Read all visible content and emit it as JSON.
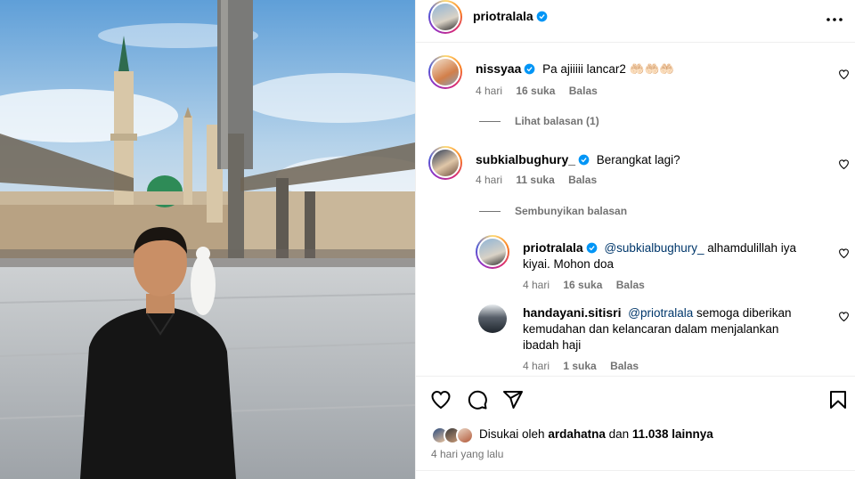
{
  "post": {
    "author": "priotralala",
    "author_verified": true
  },
  "comments": [
    {
      "username": "nissyaa",
      "verified": true,
      "text": "Pa ajiiiii lancar2 🤲🏻🤲🏻🤲🏻",
      "time": "4 hari",
      "likes": "16 suka",
      "reply_label": "Balas",
      "replies_toggle": "Lihat balasan (1)"
    },
    {
      "username": "subkialbughury_",
      "verified": true,
      "text": "Berangkat lagi?",
      "time": "4 hari",
      "likes": "11 suka",
      "reply_label": "Balas",
      "replies_toggle": "Sembunyikan balasan",
      "replies": [
        {
          "username": "priotralala",
          "verified": true,
          "mention": "@subkialbughury_",
          "text": " alhamdulillah iya kiyai. Mohon doa",
          "time": "4 hari",
          "likes": "16 suka",
          "reply_label": "Balas"
        },
        {
          "username": "handayani.sitisri",
          "verified": false,
          "mention": "@priotralala",
          "text": " semoga diberikan kemudahan dan kelancaran dalam menjalankan ibadah haji",
          "time": "4 hari",
          "likes": "1 suka",
          "reply_label": "Balas"
        }
      ]
    }
  ],
  "actions": {
    "icons": [
      "heart-icon",
      "comment-icon",
      "share-icon",
      "bookmark-icon"
    ]
  },
  "likes_summary": {
    "prefix": "Disukai oleh",
    "user": "ardahatna",
    "joiner": "dan",
    "others": "11.038 lainnya"
  },
  "posted_time": "4 hari yang lalu",
  "colors": {
    "verified_blue": "#0095f6",
    "mention_blue": "#00376b",
    "meta_gray": "#737373"
  }
}
